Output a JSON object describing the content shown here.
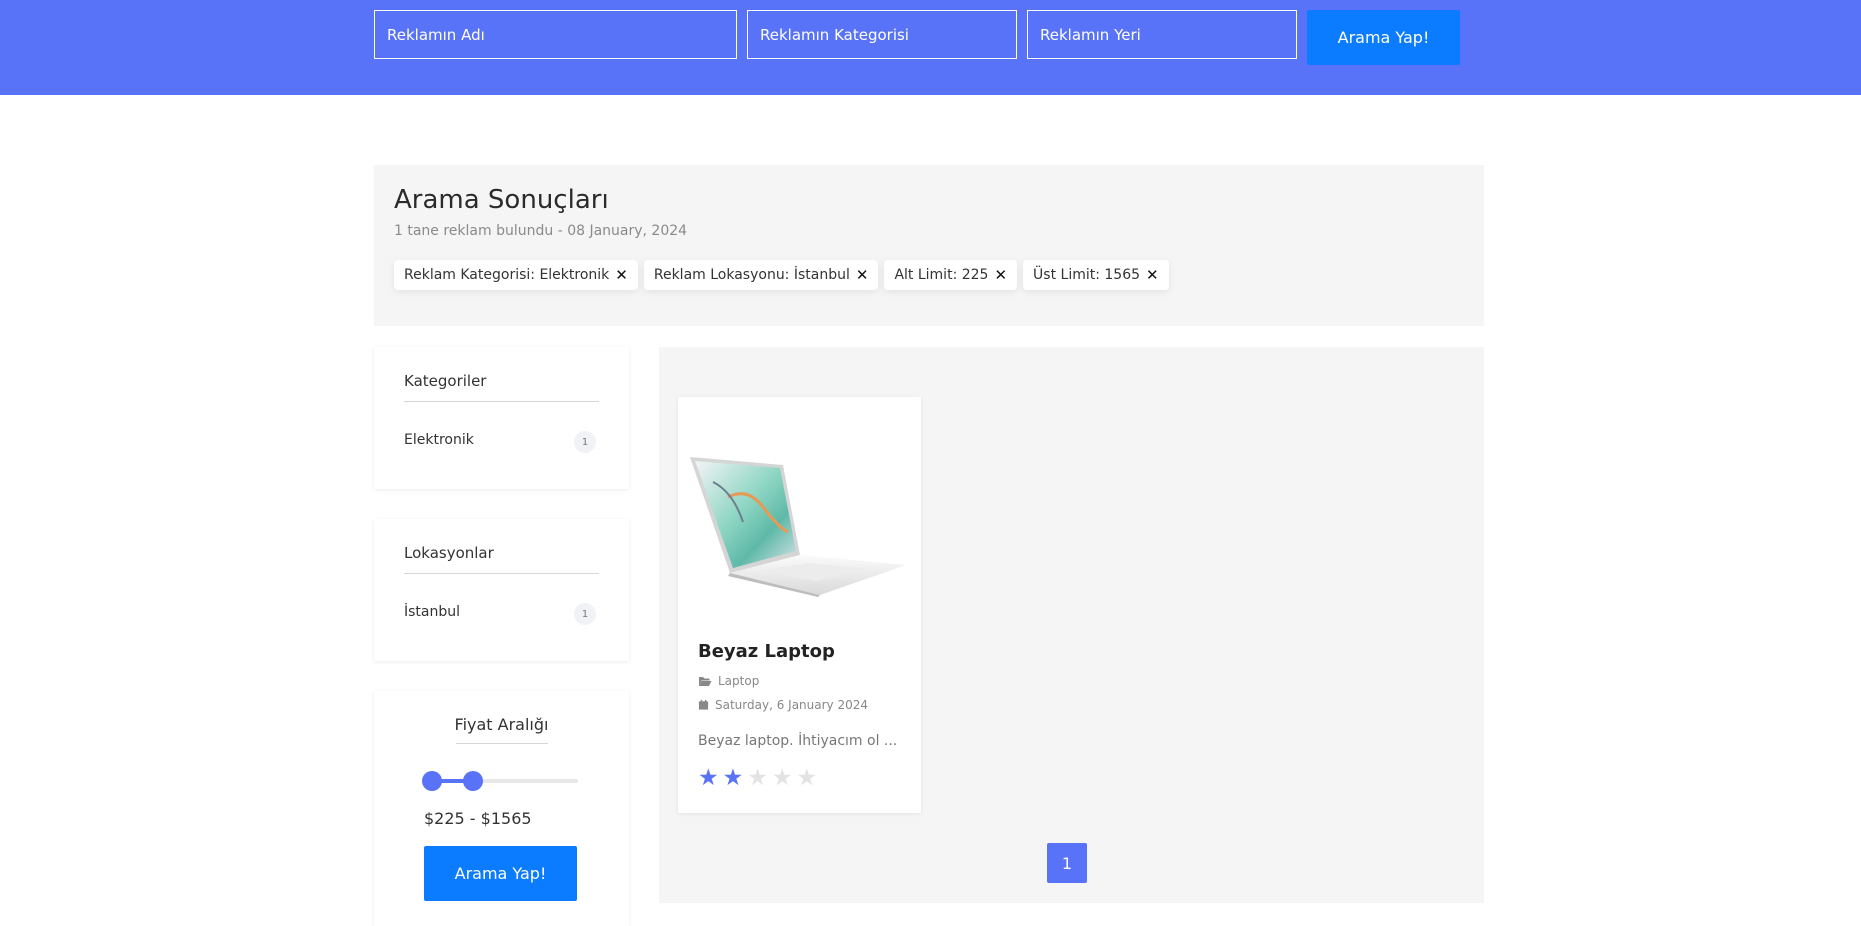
{
  "search": {
    "name_placeholder": "Reklamın Adı",
    "category_placeholder": "Reklamın Kategorisi",
    "location_placeholder": "Reklamın Yeri",
    "button_label": "Arama Yap!"
  },
  "results": {
    "title": "Arama Sonuçları",
    "subtitle": "1 tane reklam bulundu - 08 January, 2024",
    "filters": [
      {
        "label": "Reklam Kategorisi: Elektronik"
      },
      {
        "label": "Reklam Lokasyonu: İstanbul"
      },
      {
        "label": "Alt Limit: 225"
      },
      {
        "label": "Üst Limit: 1565"
      }
    ]
  },
  "sidebar": {
    "categories": {
      "title": "Kategoriler",
      "items": [
        {
          "label": "Elektronik",
          "count": "1"
        }
      ]
    },
    "locations": {
      "title": "Lokasyonlar",
      "items": [
        {
          "label": "İstanbul",
          "count": "1"
        }
      ]
    },
    "price": {
      "title": "Fiyat Aralığı",
      "range_text": "$225 - $1565",
      "slider_low_fraction": 0.05,
      "slider_high_fraction": 0.32,
      "button_label": "Arama Yap!"
    }
  },
  "listings": [
    {
      "title": "Beyaz Laptop",
      "category": "Laptop",
      "category_icon": "folder-open-icon",
      "date": "Saturday, 6 January 2024",
      "date_icon": "calendar-icon",
      "description": "Beyaz laptop. İhtiyacım ol ...",
      "rating": 2,
      "rating_max": 5
    }
  ],
  "pagination": {
    "current": "1"
  },
  "colors": {
    "brand": "#5873f8",
    "button": "#0b7cff",
    "panel_bg": "#f5f5f5"
  }
}
